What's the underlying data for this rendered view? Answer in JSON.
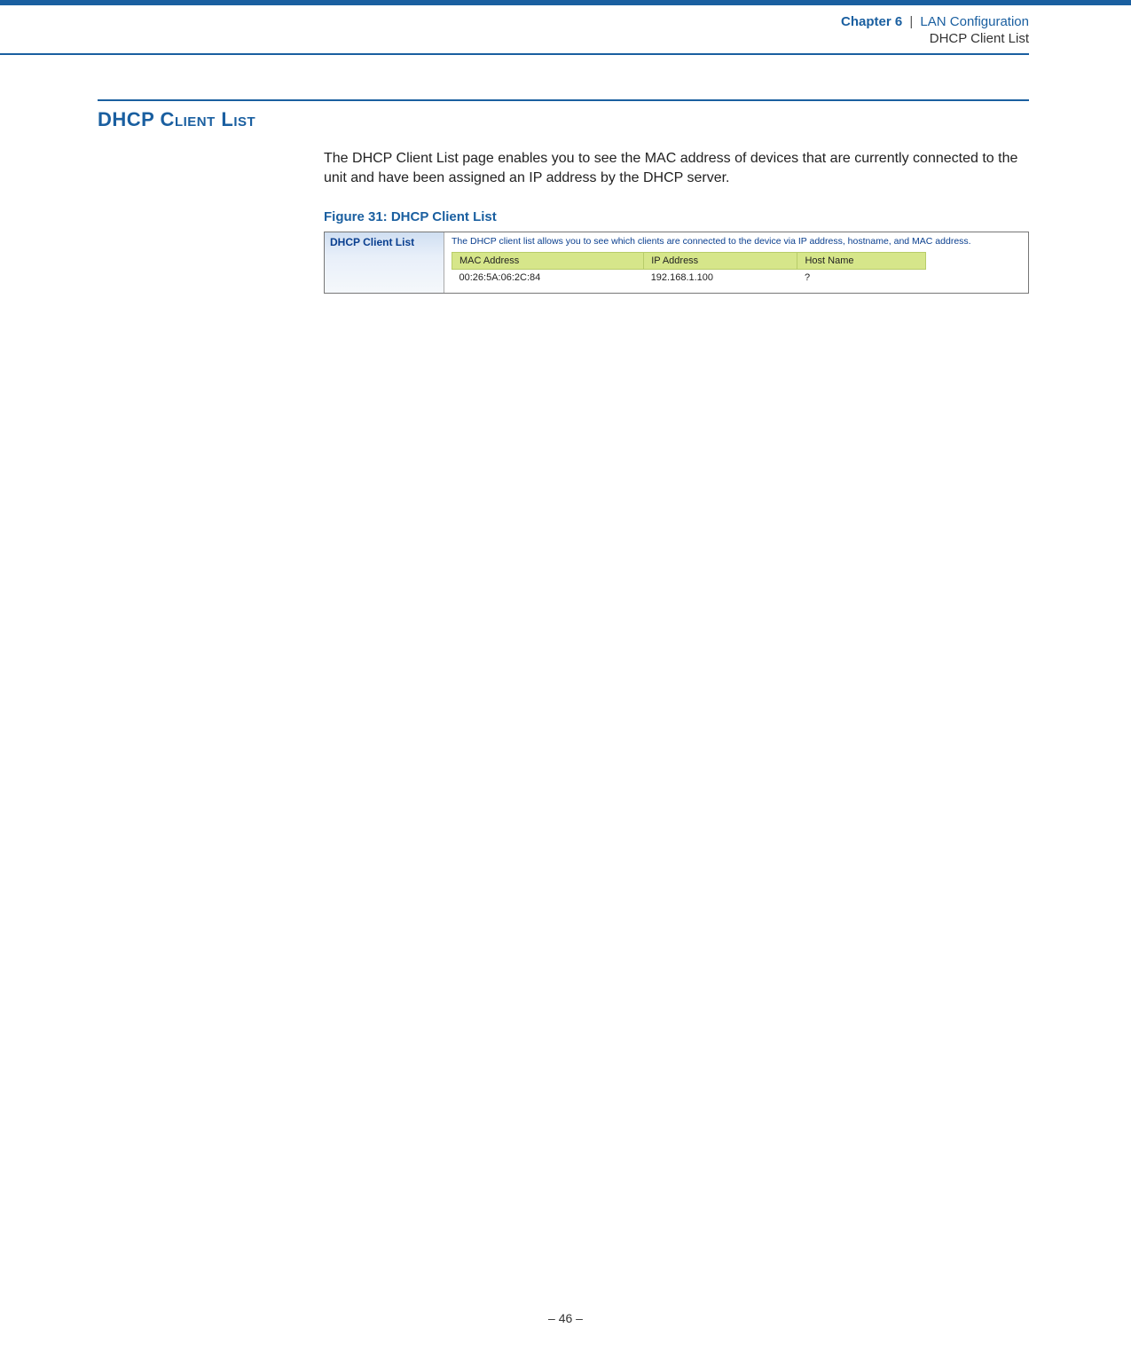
{
  "header": {
    "chapter_label": "Chapter 6",
    "separator": "|",
    "chapter_title": "LAN Configuration",
    "subsection": "DHCP Client List"
  },
  "section": {
    "heading": "DHCP Client List",
    "body": "The DHCP Client List page enables you to see the MAC address of devices that are currently connected to the unit and have been assigned an IP address by the DHCP server."
  },
  "figure": {
    "caption": "Figure 31:  DHCP Client List",
    "sidebar_title": "DHCP Client List",
    "description": "The DHCP client list allows you to see which clients are connected to the device via IP address, hostname, and MAC address.",
    "table": {
      "headers": [
        "MAC Address",
        "IP Address",
        "Host Name"
      ],
      "rows": [
        {
          "mac": "00:26:5A:06:2C:84",
          "ip": "192.168.1.100",
          "host": "?"
        }
      ]
    }
  },
  "footer": {
    "page": "–  46  –"
  }
}
